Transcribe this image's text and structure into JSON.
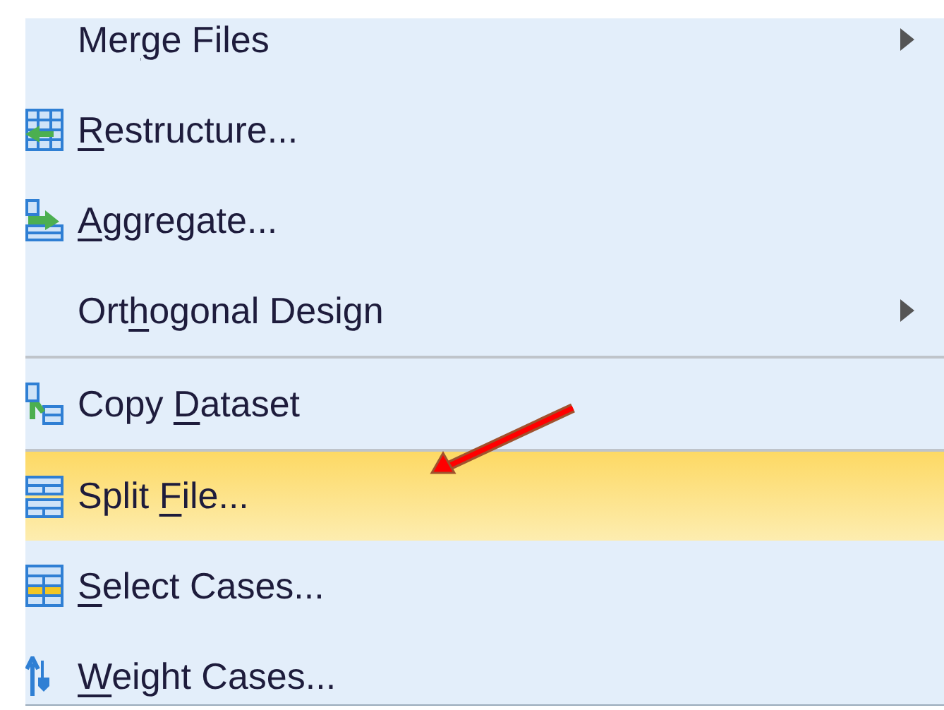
{
  "menu": {
    "items": [
      {
        "label": {
          "pre": "Mer",
          "key": "g",
          "post": "e Files"
        },
        "submenu": true,
        "separator_before": false,
        "selected": false
      },
      {
        "label": {
          "key": "R",
          "post": "estructure..."
        },
        "submenu": false,
        "separator_before": false,
        "selected": false
      },
      {
        "label": {
          "key": "A",
          "post": "ggregate..."
        },
        "submenu": false,
        "separator_before": false,
        "selected": false
      },
      {
        "label": {
          "pre": "Ort",
          "key": "h",
          "post": "ogonal Design"
        },
        "submenu": true,
        "separator_before": false,
        "selected": false
      },
      {
        "label": {
          "pre": "Copy ",
          "key": "D",
          "post": "ataset"
        },
        "submenu": false,
        "separator_before": true,
        "selected": false
      },
      {
        "label": {
          "pre": "Split ",
          "key": "F",
          "post": "ile..."
        },
        "submenu": false,
        "separator_before": true,
        "selected": true
      },
      {
        "label": {
          "key": "S",
          "post": "elect Cases..."
        },
        "submenu": false,
        "separator_before": false,
        "selected": false
      },
      {
        "label": {
          "key": "W",
          "post": "eight Cases..."
        },
        "submenu": false,
        "separator_before": false,
        "selected": false
      }
    ]
  }
}
